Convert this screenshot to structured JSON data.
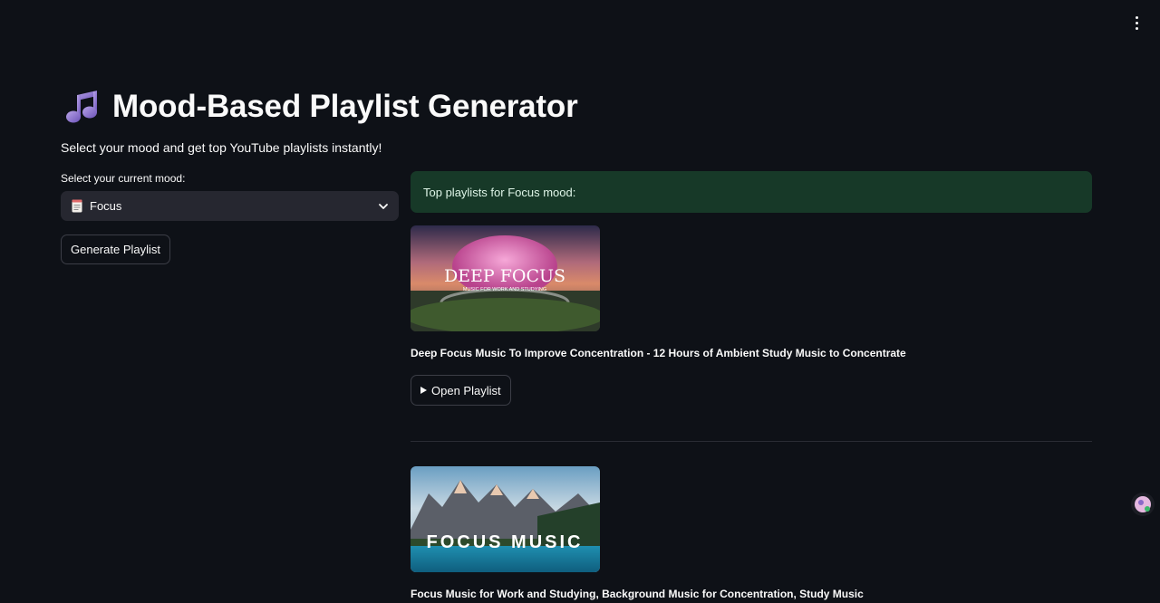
{
  "header": {
    "title": "Mood-Based Playlist Generator",
    "title_icon": "music-notes-icon",
    "subtitle": "Select your mood and get top YouTube playlists instantly!"
  },
  "mood_select": {
    "label": "Select your current mood:",
    "selected_emoji": "memo-icon",
    "selected": "Focus"
  },
  "generate_button": {
    "label": "Generate Playlist"
  },
  "results": {
    "alert_text": "Top playlists for Focus mood:",
    "playlists": [
      {
        "thumbnail_heading": "DEEP FOCUS",
        "thumbnail_subheading": "MUSIC FOR WORK AND STUDYING",
        "title": "Deep Focus Music To Improve Concentration - 12 Hours of Ambient Study Music to Concentrate",
        "button_label": "Open Playlist",
        "button_icon": "play-triangle-icon"
      },
      {
        "thumbnail_heading": "FOCUS MUSIC",
        "title": "Focus Music for Work and Studying, Background Music for Concentration, Study Music"
      }
    ]
  },
  "colors": {
    "background": "#0e1117",
    "text": "#fafafa",
    "select_bg": "#262730",
    "alert_bg": "#173928",
    "button_border": "#3c3e47"
  }
}
